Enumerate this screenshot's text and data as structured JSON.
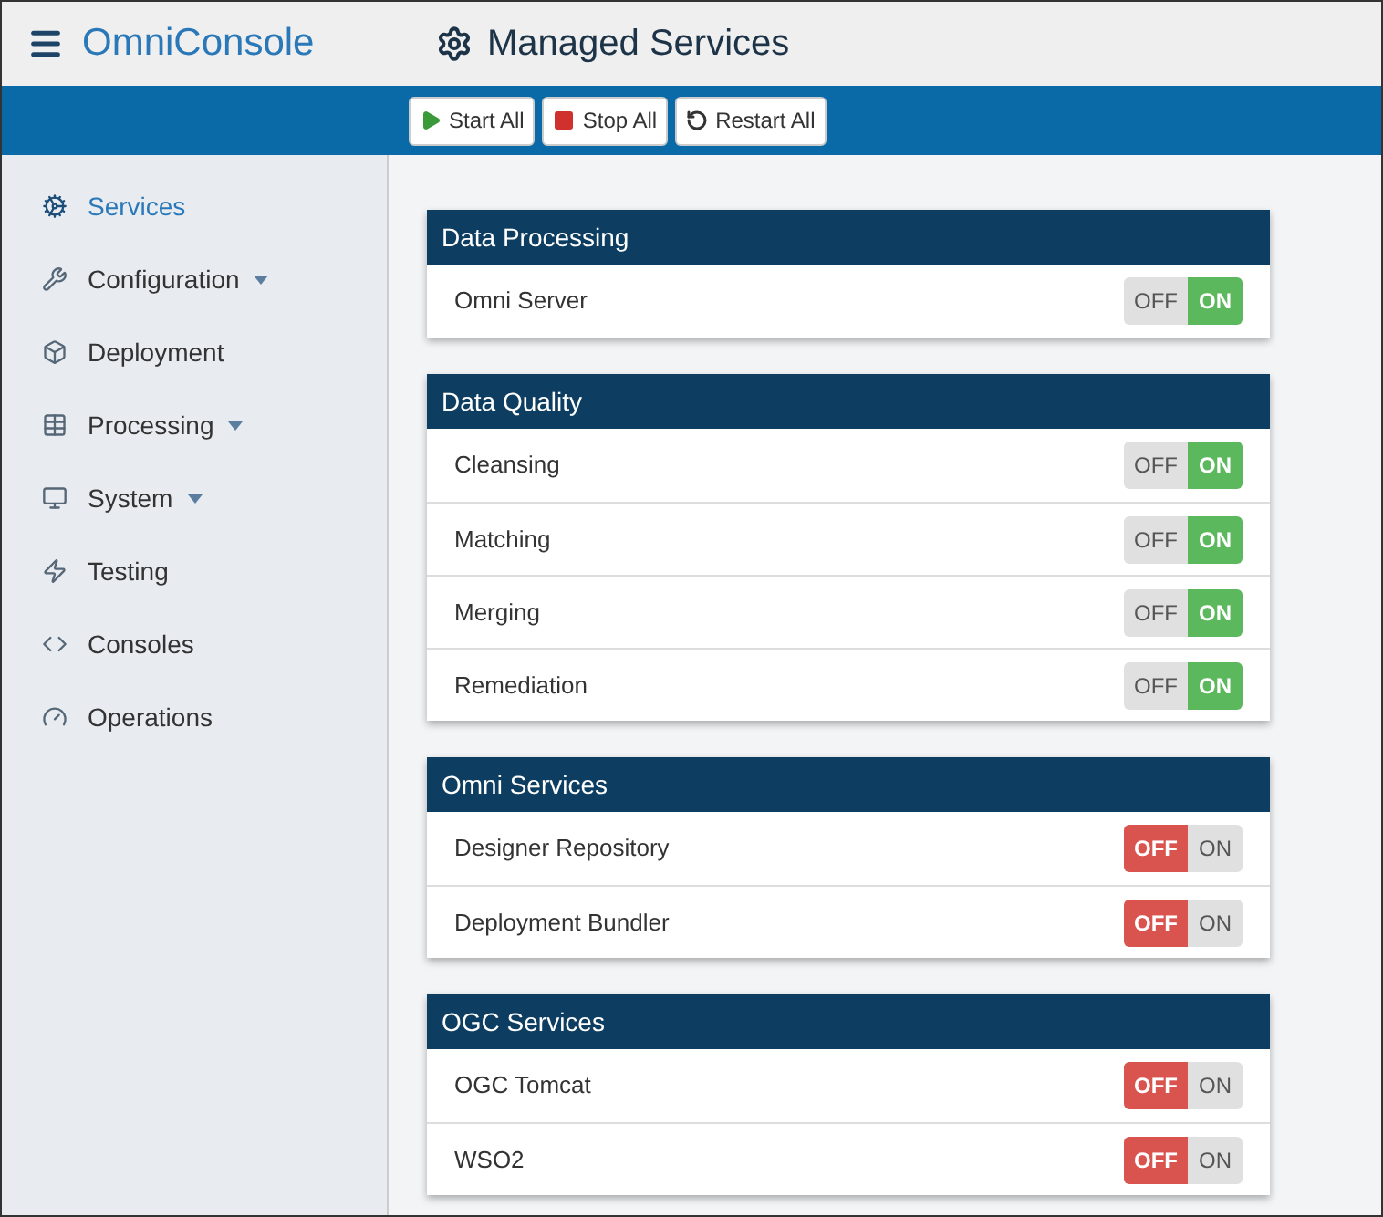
{
  "header": {
    "logo": "OmniConsole",
    "title": "Managed Services"
  },
  "toolbar": {
    "buttons": [
      {
        "label": "Start All",
        "kind": "start"
      },
      {
        "label": "Stop All",
        "kind": "stop"
      },
      {
        "label": "Restart All",
        "kind": "restart"
      }
    ]
  },
  "sidebar": {
    "items": [
      {
        "label": "Services",
        "selected": true,
        "has_menu": false
      },
      {
        "label": "Configuration",
        "selected": false,
        "has_menu": true
      },
      {
        "label": "Deployment",
        "selected": false,
        "has_menu": false
      },
      {
        "label": "Processing",
        "selected": false,
        "has_menu": true
      },
      {
        "label": "System",
        "selected": false,
        "has_menu": true
      },
      {
        "label": "Testing",
        "selected": false,
        "has_menu": false
      },
      {
        "label": "Consoles",
        "selected": false,
        "has_menu": false
      },
      {
        "label": "Operations",
        "selected": false,
        "has_menu": false
      }
    ]
  },
  "groups": [
    {
      "title": "Data Processing",
      "services": [
        {
          "name": "Omni Server",
          "on": true,
          "off_label": "OFF",
          "on_label": "ON"
        }
      ]
    },
    {
      "title": "Data Quality",
      "services": [
        {
          "name": "Cleansing",
          "on": true,
          "off_label": "OFF",
          "on_label": "ON"
        },
        {
          "name": "Matching",
          "on": true,
          "off_label": "OFF",
          "on_label": "ON"
        },
        {
          "name": "Merging",
          "on": true,
          "off_label": "OFF",
          "on_label": "ON"
        },
        {
          "name": "Remediation",
          "on": true,
          "off_label": "OFF",
          "on_label": "ON"
        }
      ]
    },
    {
      "title": "Omni Services",
      "services": [
        {
          "name": "Designer Repository",
          "on": false,
          "off_label": "OFF",
          "on_label": "ON"
        },
        {
          "name": "Deployment Bundler",
          "on": false,
          "off_label": "OFF",
          "on_label": "ON"
        }
      ]
    },
    {
      "title": "OGC Services",
      "services": [
        {
          "name": "OGC Tomcat",
          "on": false,
          "off_label": "OFF",
          "on_label": "ON"
        },
        {
          "name": "WSO2",
          "on": false,
          "off_label": "OFF",
          "on_label": "ON"
        }
      ]
    }
  ]
}
